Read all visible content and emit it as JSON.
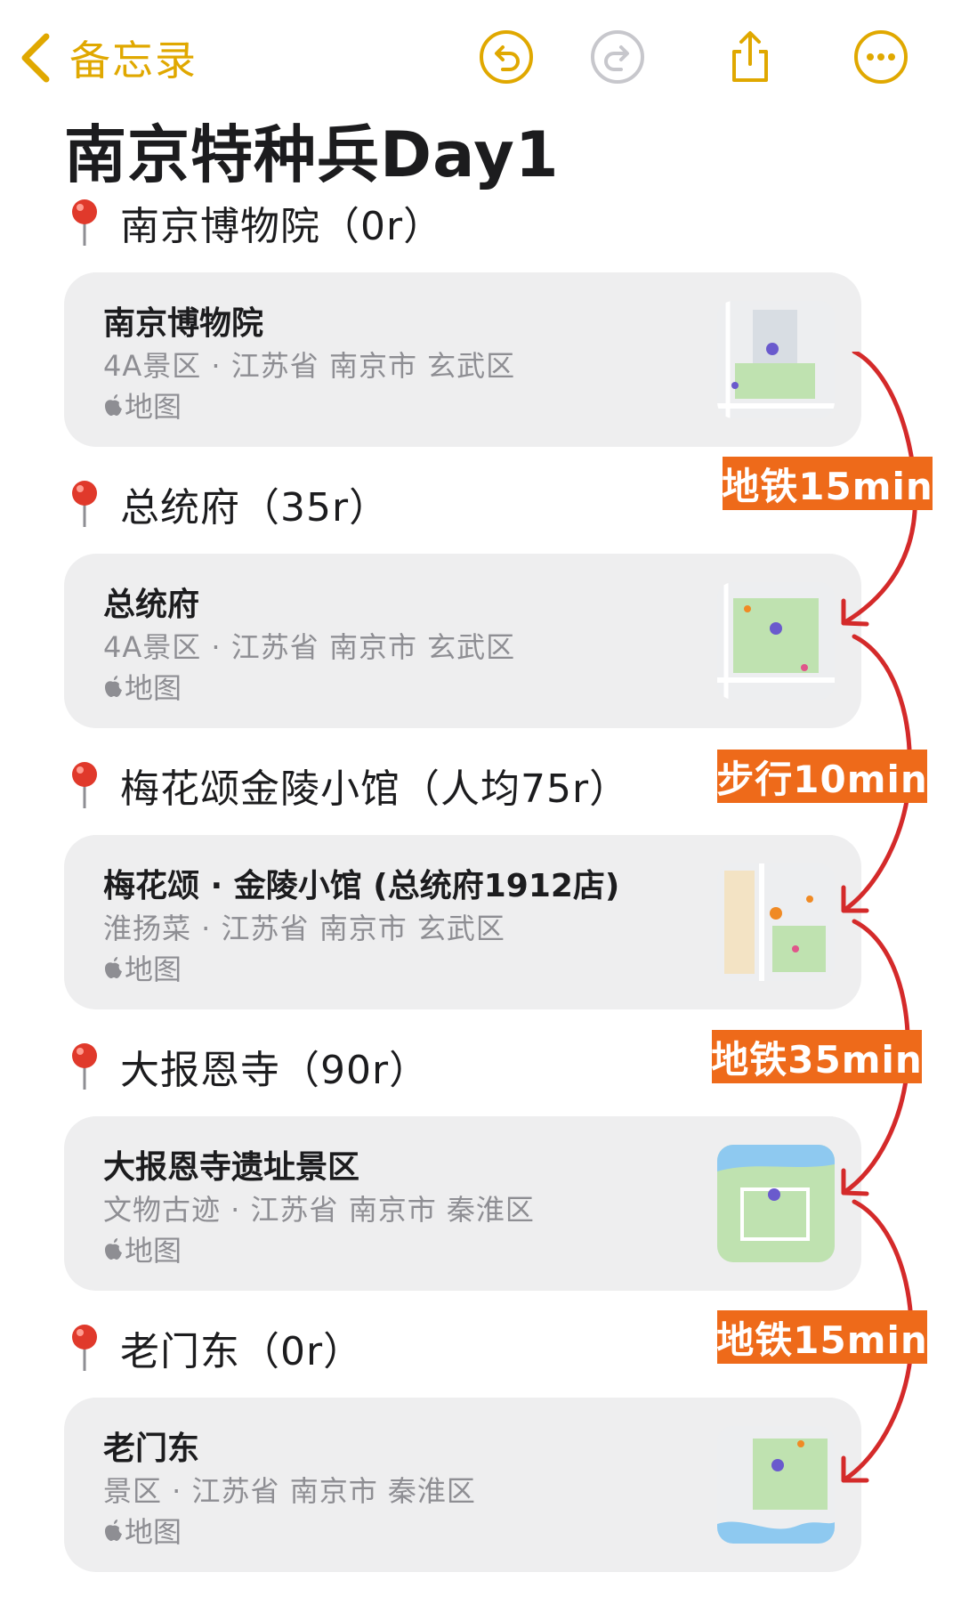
{
  "nav": {
    "back_label": "备忘录"
  },
  "note": {
    "title": "南京特种兵Day1"
  },
  "stops": [
    {
      "header": "南京博物院（0r）",
      "name": "南京博物院",
      "subtitle": "4A景区 · 江苏省 南京市 玄武区",
      "source": "地图"
    },
    {
      "header": "总统府（35r）",
      "name": "总统府",
      "subtitle": "4A景区 · 江苏省 南京市 玄武区",
      "source": "地图"
    },
    {
      "header": "梅花颂金陵小馆（人均75r）",
      "name": "梅花颂 · 金陵小馆 (总统府1912店)",
      "subtitle": "淮扬菜 · 江苏省 南京市 玄武区",
      "source": "地图"
    },
    {
      "header": "大报恩寺（90r）",
      "name": "大报恩寺遗址景区",
      "subtitle": "文物古迹 · 江苏省 南京市 秦淮区",
      "source": "地图"
    },
    {
      "header": "老门东（0r）",
      "name": "老门东",
      "subtitle": "景区 · 江苏省 南京市 秦淮区",
      "source": "地图"
    }
  ],
  "transits": [
    "地铁15min",
    "步行10min",
    "地铁35min",
    "地铁15min"
  ],
  "colors": {
    "accent": "#e0a800",
    "transit_badge": "#ee6a1a",
    "route_arrow": "#d42a2a",
    "pin": "#e0392b"
  },
  "icons": [
    "chevron-left-icon",
    "undo-icon",
    "redo-icon",
    "share-icon",
    "more-icon",
    "map-pin-icon",
    "apple-logo-icon",
    "map-thumbnail"
  ]
}
